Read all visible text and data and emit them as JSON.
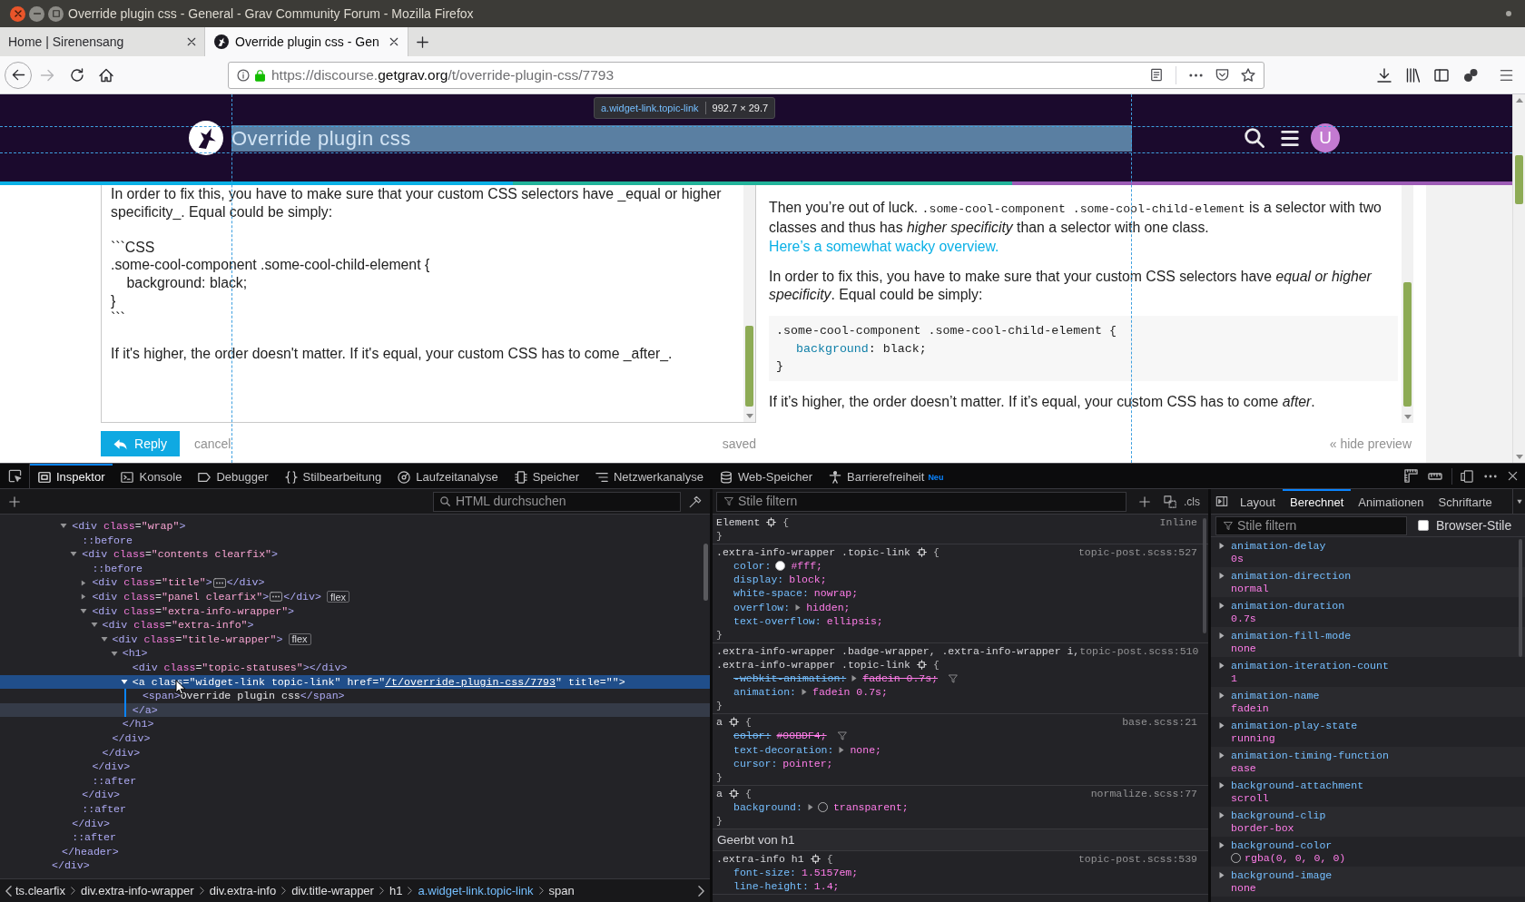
{
  "window": {
    "title": "Override plugin css - General - Grav Community Forum - Mozilla Firefox"
  },
  "tabs": [
    {
      "label": "Home | Sirenensang",
      "selected": false,
      "favicon": false
    },
    {
      "label": "Override plugin css - Gen",
      "selected": true,
      "favicon": true
    }
  ],
  "address_bar": {
    "url": [
      {
        "kind": "dim",
        "text": "https://discourse."
      },
      {
        "kind": "domain",
        "text": "getgrav.org"
      },
      {
        "kind": "dim",
        "text": "/t/override-plugin-css/7793"
      }
    ]
  },
  "page": {
    "header": {
      "title": "Override plugin css",
      "highlighted": true,
      "avatar": "U"
    },
    "highlighter_tooltip": {
      "selector": "a.widget-link.topic-link",
      "size": "992.7 × 29.7"
    },
    "editor": {
      "value": "In order to fix this, you have to make sure that your custom CSS selectors have _equal or higher specificity_. Equal could be simply:\n\n```CSS\n.some-cool-component .some-cool-child-element {\n    background: black;\n}\n```\n\nIf it's higher, the order doesn't matter. If it's equal, your custom CSS has to come _after_."
    },
    "preview": [
      {
        "kind": "paragraph",
        "parts": [
          {
            "kind": "text",
            "text": "Then you’re out of luck. "
          },
          {
            "kind": "code",
            "text": ".some-cool-component .some-cool-child-element"
          },
          {
            "kind": "text",
            "text": " is a selector with two classes and thus has *higher specificity* than a selector with one class. "
          },
          {
            "kind": "link",
            "text": "Here’s a somewhat wacky overview."
          }
        ]
      },
      {
        "kind": "paragraph",
        "parts": [
          {
            "kind": "text",
            "text": "In order to fix this, you have to make sure that your custom CSS selectors have *equal or higher specificity*. Equal could be simply:"
          }
        ]
      },
      {
        "kind": "code_block",
        "lines": [
          {
            "kind": "plain",
            "tokens": [
              {
                "kind": "plain",
                "text": ".some-cool-component .some-cool-child-element {"
              }
            ]
          },
          {
            "kind": "indented",
            "tokens": [
              {
                "kind": "property",
                "text": "background"
              },
              {
                "kind": "plain",
                "text": ": black;"
              }
            ]
          },
          {
            "kind": "plain",
            "tokens": [
              {
                "kind": "plain",
                "text": "}"
              }
            ]
          }
        ]
      },
      {
        "kind": "paragraph",
        "parts": [
          {
            "kind": "text",
            "text": "If it’s higher, the order doesn’t matter. If it’s equal, your custom CSS has to come *after*."
          }
        ]
      }
    ],
    "actions": {
      "reply": "Reply",
      "cancel": "cancel",
      "status": "saved",
      "toggle_preview": "« hide preview"
    }
  },
  "devtools": {
    "tools": [
      {
        "label": "Inspektor",
        "selected": true
      },
      {
        "label": "Konsole",
        "selected": false
      },
      {
        "label": "Debugger",
        "selected": false
      },
      {
        "label": "Stilbearbeitung",
        "selected": false
      },
      {
        "label": "Laufzeitanalyse",
        "selected": false
      },
      {
        "label": "Speicher",
        "selected": false
      },
      {
        "label": "Netzwerkanalyse",
        "selected": false
      },
      {
        "label": "Web-Speicher",
        "selected": false
      },
      {
        "label": "Barrierefreiheit",
        "selected": false,
        "badge": "Neu"
      }
    ],
    "markup_search": {
      "placeholder": "HTML durchsuchen"
    },
    "markup": [
      {
        "selected": false,
        "close": [
          {
            "kind": "tag",
            "text": "</div>"
          }
        ],
        "children": [
          {
            "selected": false,
            "close": [
              {
                "kind": "tag",
                "text": "</header>"
              }
            ],
            "children": [
              {
                "selected": false,
                "expanded": true,
                "open": [
                  {
                    "kind": "tag",
                    "text": "<div"
                  },
                  {
                    "kind": "attr",
                    "text": " class"
                  },
                  {
                    "kind": "eq",
                    "text": "="
                  },
                  {
                    "kind": "value",
                    "text": "\"wrap\""
                  },
                  {
                    "kind": "tag",
                    "text": ">"
                  }
                ],
                "close": [
                  {
                    "kind": "tag",
                    "text": "</div>"
                  }
                ],
                "children": [
                  {
                    "selected": false,
                    "open": [
                      {
                        "kind": "pseudo",
                        "text": "::before"
                      }
                    ]
                  },
                  {
                    "selected": false,
                    "expanded": true,
                    "open": [
                      {
                        "kind": "tag",
                        "text": "<div"
                      },
                      {
                        "kind": "attr",
                        "text": " class"
                      },
                      {
                        "kind": "eq",
                        "text": "="
                      },
                      {
                        "kind": "value",
                        "text": "\"contents clearfix\""
                      },
                      {
                        "kind": "tag",
                        "text": ">"
                      }
                    ],
                    "close": [
                      {
                        "kind": "tag",
                        "text": "</div>"
                      }
                    ],
                    "children": [
                      {
                        "selected": false,
                        "open": [
                          {
                            "kind": "pseudo",
                            "text": "::before"
                          }
                        ]
                      },
                      {
                        "selected": false,
                        "expanded": false,
                        "ellipsis": true,
                        "open": [
                          {
                            "kind": "tag",
                            "text": "<div"
                          },
                          {
                            "kind": "attr",
                            "text": " class"
                          },
                          {
                            "kind": "eq",
                            "text": "="
                          },
                          {
                            "kind": "value",
                            "text": "\"title\""
                          },
                          {
                            "kind": "tag",
                            "text": ">"
                          }
                        ],
                        "close": [
                          {
                            "kind": "tag",
                            "text": "</div>"
                          }
                        ]
                      },
                      {
                        "selected": false,
                        "expanded": false,
                        "ellipsis": true,
                        "badge": "flex",
                        "open": [
                          {
                            "kind": "tag",
                            "text": "<div"
                          },
                          {
                            "kind": "attr",
                            "text": " class"
                          },
                          {
                            "kind": "eq",
                            "text": "="
                          },
                          {
                            "kind": "value",
                            "text": "\"panel clearfix\""
                          },
                          {
                            "kind": "tag",
                            "text": ">"
                          }
                        ],
                        "close": [
                          {
                            "kind": "tag",
                            "text": "</div>"
                          }
                        ]
                      },
                      {
                        "selected": false,
                        "expanded": true,
                        "open": [
                          {
                            "kind": "tag",
                            "text": "<div"
                          },
                          {
                            "kind": "attr",
                            "text": " class"
                          },
                          {
                            "kind": "eq",
                            "text": "="
                          },
                          {
                            "kind": "value",
                            "text": "\"extra-info-wrapper\""
                          },
                          {
                            "kind": "tag",
                            "text": ">"
                          }
                        ],
                        "close": [
                          {
                            "kind": "tag",
                            "text": "</div>"
                          }
                        ],
                        "children": [
                          {
                            "selected": false,
                            "expanded": true,
                            "open": [
                              {
                                "kind": "tag",
                                "text": "<div"
                              },
                              {
                                "kind": "attr",
                                "text": " class"
                              },
                              {
                                "kind": "eq",
                                "text": "="
                              },
                              {
                                "kind": "value",
                                "text": "\"extra-info\""
                              },
                              {
                                "kind": "tag",
                                "text": ">"
                              }
                            ],
                            "close": [
                              {
                                "kind": "tag",
                                "text": "</div>"
                              }
                            ],
                            "children": [
                              {
                                "selected": false,
                                "expanded": true,
                                "badge": "flex",
                                "open": [
                                  {
                                    "kind": "tag",
                                    "text": "<div"
                                  },
                                  {
                                    "kind": "attr",
                                    "text": " class"
                                  },
                                  {
                                    "kind": "eq",
                                    "text": "="
                                  },
                                  {
                                    "kind": "value",
                                    "text": "\"title-wrapper\""
                                  },
                                  {
                                    "kind": "tag",
                                    "text": ">"
                                  }
                                ],
                                "close": [
                                  {
                                    "kind": "tag",
                                    "text": "</div>"
                                  }
                                ],
                                "children": [
                                  {
                                    "selected": false,
                                    "expanded": true,
                                    "open": [
                                      {
                                        "kind": "tag",
                                        "text": "<h1>"
                                      }
                                    ],
                                    "close": [
                                      {
                                        "kind": "tag",
                                        "text": "</h1>"
                                      }
                                    ],
                                    "children": [
                                      {
                                        "selected": false,
                                        "open": [
                                          {
                                            "kind": "tag",
                                            "text": "<div"
                                          },
                                          {
                                            "kind": "attr",
                                            "text": " class"
                                          },
                                          {
                                            "kind": "eq",
                                            "text": "="
                                          },
                                          {
                                            "kind": "value",
                                            "text": "\"topic-statuses\""
                                          },
                                          {
                                            "kind": "tag",
                                            "text": "></div>"
                                          }
                                        ]
                                      },
                                      {
                                        "selected": true,
                                        "expanded": true,
                                        "open": [
                                          {
                                            "kind": "tag",
                                            "text": "<a"
                                          },
                                          {
                                            "kind": "attr",
                                            "text": " class"
                                          },
                                          {
                                            "kind": "eq",
                                            "text": "="
                                          },
                                          {
                                            "kind": "value",
                                            "text": "\"widget-link topic-link\""
                                          },
                                          {
                                            "kind": "attr",
                                            "text": " href"
                                          },
                                          {
                                            "kind": "eq",
                                            "text": "="
                                          },
                                          {
                                            "kind": "value",
                                            "text": "\""
                                          },
                                          {
                                            "kind": "link",
                                            "text": "/t/override-plugin-css/7793"
                                          },
                                          {
                                            "kind": "value",
                                            "text": "\""
                                          },
                                          {
                                            "kind": "attr",
                                            "text": " title"
                                          },
                                          {
                                            "kind": "eq",
                                            "text": "="
                                          },
                                          {
                                            "kind": "value",
                                            "text": "\"\""
                                          },
                                          {
                                            "kind": "tag",
                                            "text": ">"
                                          }
                                        ],
                                        "close": [
                                          {
                                            "kind": "tag",
                                            "text": "</a>"
                                          }
                                        ],
                                        "children": [
                                          {
                                            "selected": false,
                                            "open": [
                                              {
                                                "kind": "tag",
                                                "text": "<span>"
                                              },
                                              {
                                                "kind": "text",
                                                "text": "Override plugin css"
                                              },
                                              {
                                                "kind": "tag",
                                                "text": "</span>"
                                              }
                                            ]
                                          }
                                        ]
                                      }
                                    ]
                                  }
                                ]
                              }
                            ]
                          }
                        ]
                      },
                      {
                        "selected": false,
                        "open": [
                          {
                            "kind": "pseudo",
                            "text": "::after"
                          }
                        ]
                      }
                    ]
                  },
                  {
                    "selected": false,
                    "open": [
                      {
                        "kind": "pseudo",
                        "text": "::after"
                      }
                    ]
                  }
                ]
              },
              {
                "selected": false,
                "open": [
                  {
                    "kind": "pseudo",
                    "text": "::after"
                  }
                ]
              }
            ]
          }
        ]
      }
    ],
    "breadcrumbs": [
      {
        "label": "ts.clearfix",
        "selected": false
      },
      {
        "label": "div.extra-info-wrapper",
        "selected": false
      },
      {
        "label": "div.extra-info",
        "selected": false
      },
      {
        "label": "div.title-wrapper",
        "selected": false
      },
      {
        "label": "h1",
        "selected": false
      },
      {
        "label": "a.widget-link.topic-link",
        "selected": true
      },
      {
        "label": "span",
        "selected": false
      }
    ],
    "rules_filter": {
      "placeholder": "Stile filtern"
    },
    "class_toggle": ".cls",
    "rules": [
      {
        "kind": "rule",
        "selectors": [
          "Element"
        ],
        "source": "Inline",
        "open": "{",
        "close": "}"
      },
      {
        "kind": "rule",
        "selectors": [
          ".extra-info-wrapper .topic-link"
        ],
        "source": "topic-post.scss:527",
        "open": "{",
        "close": "}",
        "declarations": [
          {
            "property": "color:",
            "value": "#fff;",
            "swatch": true,
            "expandable": false,
            "overridden": false
          },
          {
            "property": "display:",
            "value": "block;",
            "swatch": false,
            "expandable": false,
            "overridden": false
          },
          {
            "property": "white-space:",
            "value": "nowrap;",
            "swatch": false,
            "expandable": false,
            "overridden": false
          },
          {
            "property": "overflow:",
            "value": "hidden;",
            "swatch": false,
            "expandable": true,
            "overridden": false
          },
          {
            "property": "text-overflow:",
            "value": "ellipsis;",
            "swatch": false,
            "expandable": false,
            "overridden": false
          }
        ]
      },
      {
        "kind": "rule",
        "selectors": [
          ".extra-info-wrapper .badge-wrapper, .extra-info-wrapper i,",
          ".extra-info-wrapper .topic-link"
        ],
        "source": "topic-post.scss:510",
        "open": "{",
        "close": "}",
        "declarations": [
          {
            "property": "-webkit-animation:",
            "value": "fadein 0.7s;",
            "swatch": false,
            "expandable": true,
            "overridden": true
          },
          {
            "property": "animation:",
            "value": "fadein 0.7s;",
            "swatch": false,
            "expandable": true,
            "overridden": false
          }
        ]
      },
      {
        "kind": "rule",
        "selectors": [
          "a"
        ],
        "source": "base.scss:21",
        "open": "{",
        "close": "}",
        "declarations": [
          {
            "property": "color:",
            "value": "#00BDF4;",
            "swatch": false,
            "expandable": false,
            "overridden": true
          },
          {
            "property": "text-decoration:",
            "value": "none;",
            "swatch": false,
            "expandable": true,
            "overridden": false
          },
          {
            "property": "cursor:",
            "value": "pointer;",
            "swatch": false,
            "expandable": false,
            "overridden": false
          }
        ]
      },
      {
        "kind": "rule",
        "selectors": [
          "a"
        ],
        "source": "normalize.scss:77",
        "open": "{",
        "close": "}",
        "declarations": [
          {
            "property": "background:",
            "value": "transparent;",
            "swatch": true,
            "expandable": true,
            "overridden": false
          }
        ]
      },
      {
        "kind": "inherited",
        "label": "Geerbt von h1"
      },
      {
        "kind": "rule",
        "selectors": [
          ".extra-info h1"
        ],
        "source": "topic-post.scss:539",
        "open": "{",
        "declarations": [
          {
            "property": "font-size:",
            "value": "1.5157em;",
            "swatch": false,
            "expandable": false,
            "overridden": false
          },
          {
            "property": "line-height:",
            "value": "1.4;",
            "swatch": false,
            "expandable": false,
            "overridden": false
          }
        ]
      }
    ],
    "sidebar_tabs": [
      {
        "label": "Layout",
        "selected": false
      },
      {
        "label": "Berechnet",
        "selected": true
      },
      {
        "label": "Animationen",
        "selected": false
      },
      {
        "label": "Schriftarte",
        "selected": false
      }
    ],
    "computed_filter": {
      "placeholder": "Stile filtern"
    },
    "browser_styles": {
      "label": "Browser-Stile",
      "checked": false
    },
    "computed": [
      {
        "name": "animation-delay",
        "value": "0s",
        "expanded": false,
        "swatch": false
      },
      {
        "name": "animation-direction",
        "value": "normal",
        "expanded": false,
        "swatch": false
      },
      {
        "name": "animation-duration",
        "value": "0.7s",
        "expanded": false,
        "swatch": false
      },
      {
        "name": "animation-fill-mode",
        "value": "none",
        "expanded": false,
        "swatch": false
      },
      {
        "name": "animation-iteration-count",
        "value": "1",
        "expanded": false,
        "swatch": false
      },
      {
        "name": "animation-name",
        "value": "fadein",
        "expanded": false,
        "swatch": false
      },
      {
        "name": "animation-play-state",
        "value": "running",
        "expanded": false,
        "swatch": false
      },
      {
        "name": "animation-timing-function",
        "value": "ease",
        "expanded": false,
        "swatch": false
      },
      {
        "name": "background-attachment",
        "value": "scroll",
        "expanded": false,
        "swatch": false
      },
      {
        "name": "background-clip",
        "value": "border-box",
        "expanded": false,
        "swatch": false
      },
      {
        "name": "background-color",
        "value": "rgba(0, 0, 0, 0)",
        "expanded": false,
        "swatch": true
      },
      {
        "name": "background-image",
        "value": "none",
        "expanded": false,
        "swatch": false
      }
    ]
  }
}
